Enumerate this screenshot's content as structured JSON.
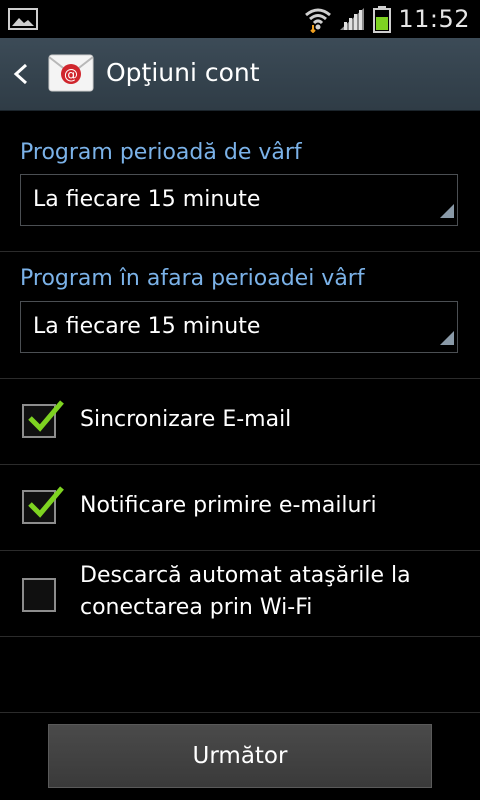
{
  "status_bar": {
    "time": "11:52",
    "icons": [
      "gallery-icon",
      "wifi-icon",
      "signal-icon",
      "battery-icon"
    ]
  },
  "action_bar": {
    "title": "Opţiuni cont",
    "back_icon": "chevron-left-icon",
    "app_icon": "email-icon"
  },
  "peak_schedule": {
    "label": "Program perioadă de vârf",
    "value": "La fiecare 15 minute"
  },
  "offpeak_schedule": {
    "label": "Program în afara perioadei vârf",
    "value": "La fiecare 15 minute"
  },
  "options": [
    {
      "label": "Sincronizare E-mail",
      "checked": true
    },
    {
      "label": "Notificare primire e-mailuri",
      "checked": true
    },
    {
      "label_line1": "Descarcă automat ataşările la",
      "label_line2": "conectarea prin Wi-Fi",
      "checked": false
    }
  ],
  "footer": {
    "next_label": "Următor"
  },
  "colors": {
    "accent_label": "#7bb2e8",
    "check_green": "#7ed321",
    "action_bar": "#34424d"
  }
}
